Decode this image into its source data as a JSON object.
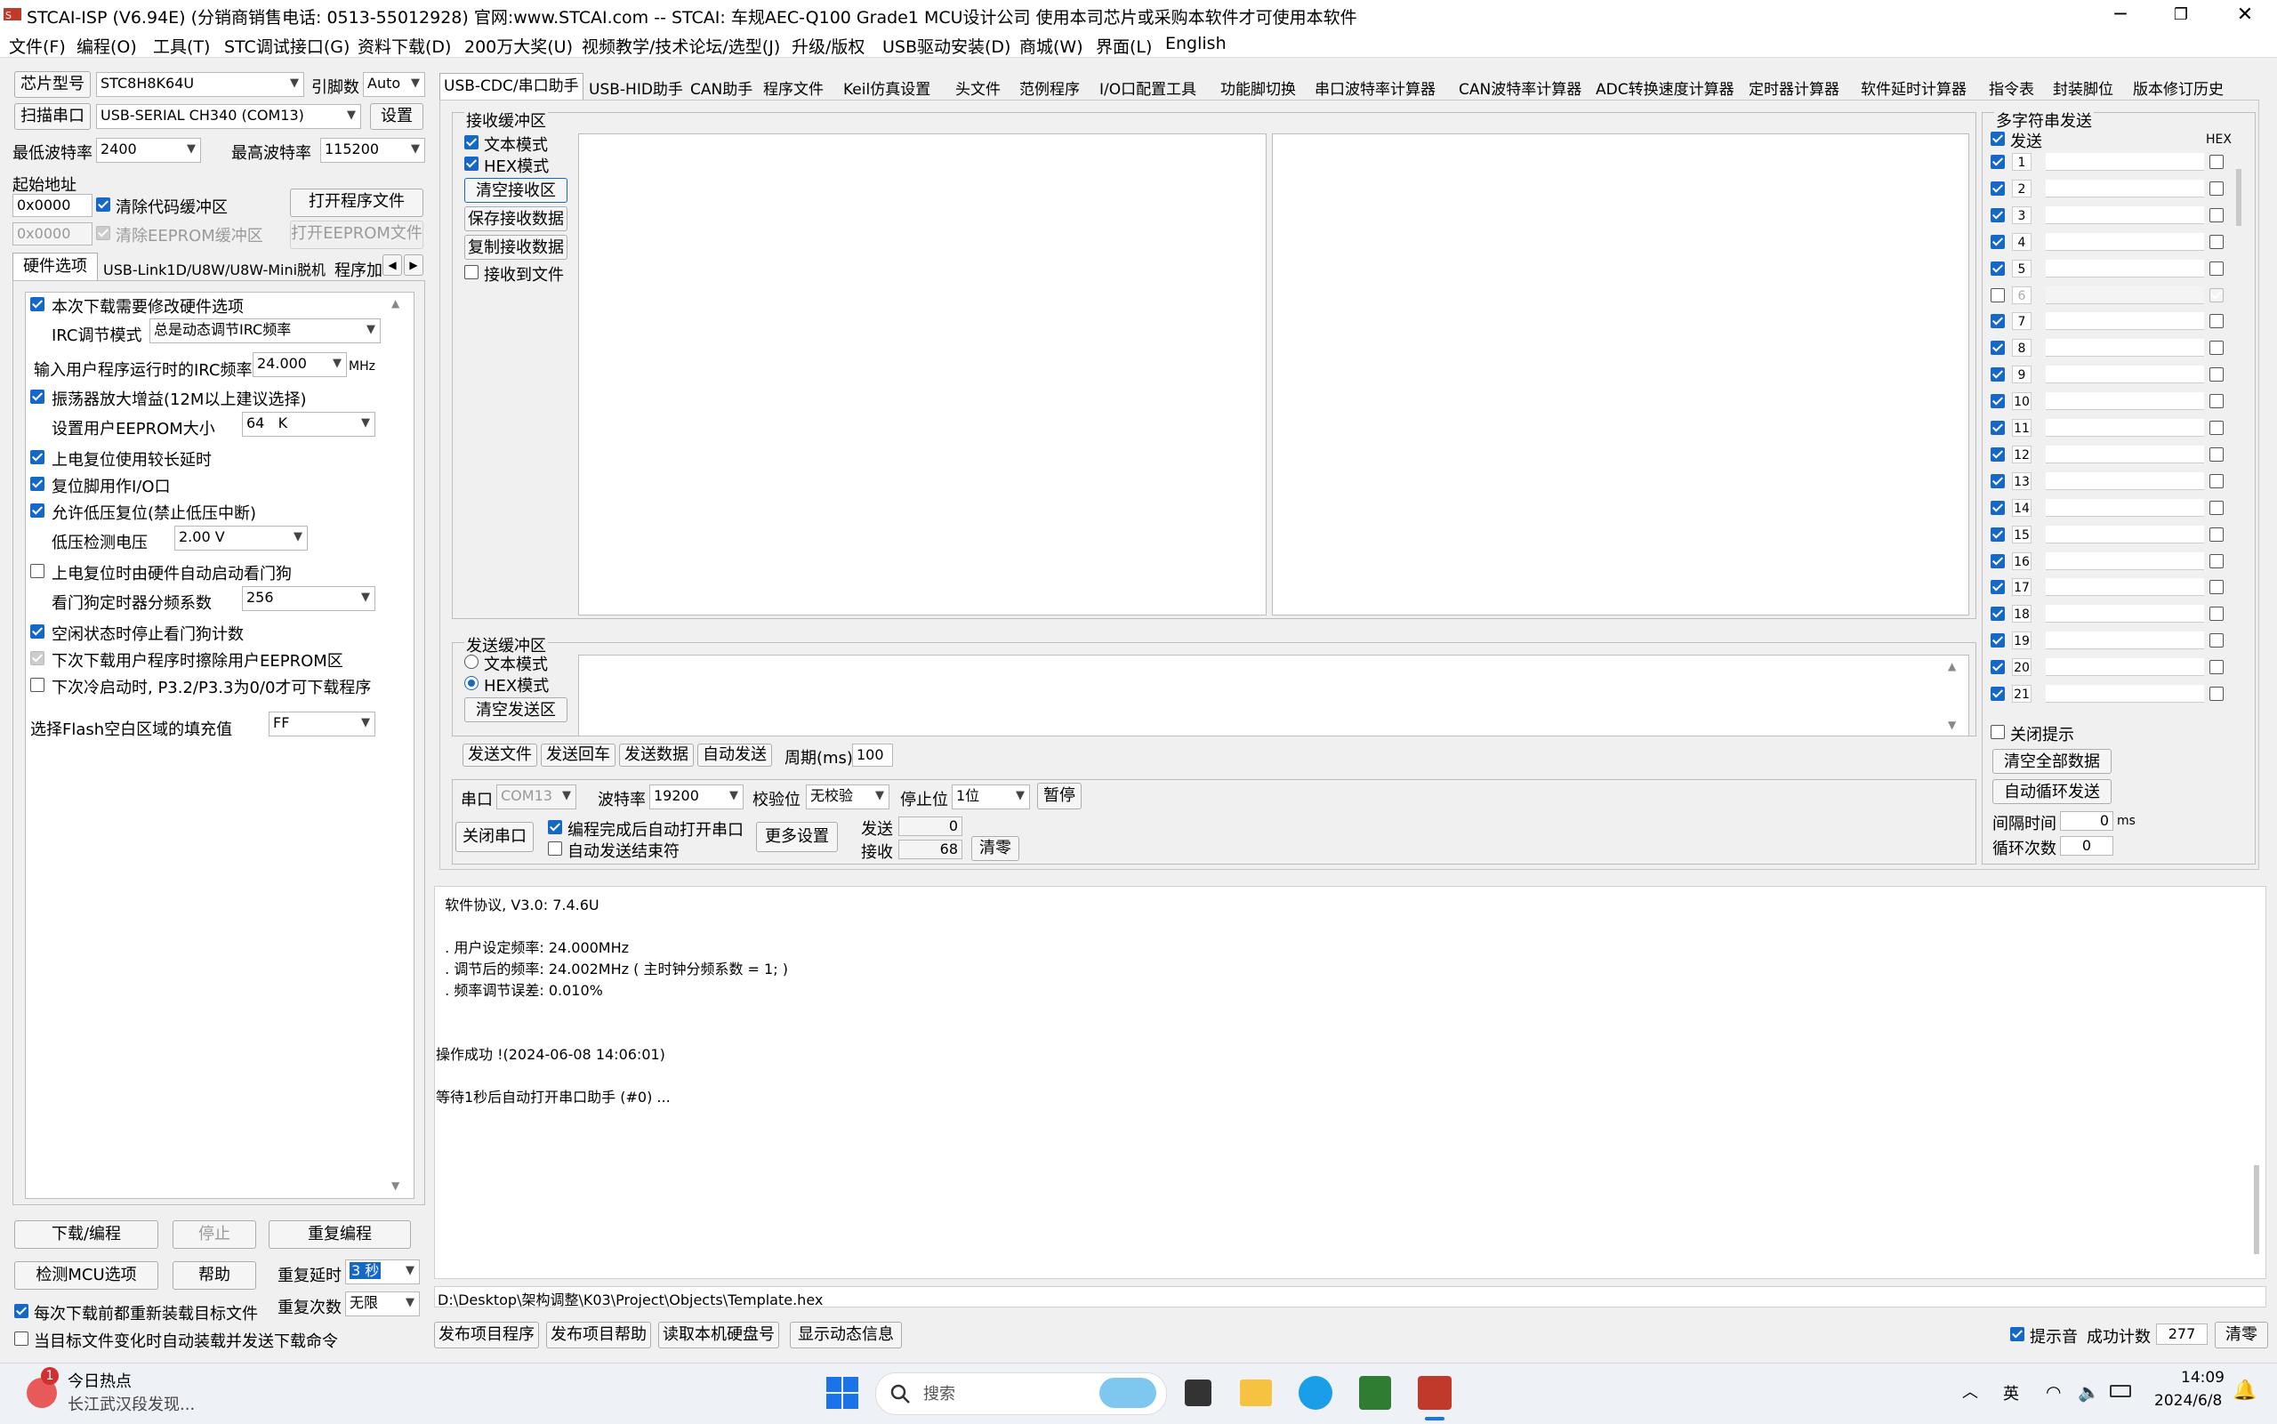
{
  "window": {
    "title": "STCAI-ISP (V6.94E) (分销商销售电话: 0513-55012928) 官网:www.STCAI.com  -- STCAI: 车规AEC-Q100 Grade1 MCU设计公司 使用本司芯片或采购本软件才可使用本软件",
    "minimize": "─",
    "maximize": "❐",
    "close": "✕"
  },
  "menu": [
    "文件(F)",
    "编程(O)",
    "工具(T)",
    "STC调试接口(G)",
    "资料下载(D)",
    "200万大奖(U)",
    "视频教学/技术论坛/选型(J)",
    "升级/版权",
    "USB驱动安装(D)",
    "商城(W)",
    "界面(L)",
    "English"
  ],
  "left": {
    "chip_label": "芯片型号",
    "chip_value": "STC8H8K64U",
    "pins_label": "引脚数",
    "pins_value": "Auto",
    "scan_btn": "扫描串口",
    "port_value": "USB-SERIAL CH340 (COM13)",
    "settings_btn": "设置",
    "min_baud_label": "最低波特率",
    "min_baud_value": "2400",
    "max_baud_label": "最高波特率",
    "max_baud_value": "115200",
    "start_addr_label": "起始地址",
    "addr1": "0x0000",
    "clear_code_label": "清除代码缓冲区",
    "open_prog_btn": "打开程序文件",
    "addr2": "0x0000",
    "clear_eeprom_label": "清除EEPROM缓冲区",
    "open_eeprom_btn": "打开EEPROM文件",
    "tabs": [
      "硬件选项",
      "USB-Link1D/U8W/U8W-Mini脱机",
      "程序加"
    ],
    "hw_options": {
      "opt1": "本次下载需要修改硬件选项",
      "irc_mode_label": "IRC调节模式",
      "irc_mode_value": "总是动态调节IRC频率",
      "irc_freq_label": "输入用户程序运行时的IRC频率",
      "irc_freq_value": "24.000",
      "irc_unit": "MHz",
      "opt_osc": "振荡器放大增益(12M以上建议选择)",
      "eeprom_size_label": "设置用户EEPROM大小",
      "eeprom_size_value": "64   K",
      "opt_reset_delay": "上电复位使用较长延时",
      "opt_reset_io": "复位脚用作I/O口",
      "opt_low_volt": "允许低压复位(禁止低压中断)",
      "low_volt_label": "低压检测电压",
      "low_volt_value": "2.00 V",
      "opt_wdt": "上电复位时由硬件自动启动看门狗",
      "wdt_div_label": "看门狗定时器分频系数",
      "wdt_div_value": "256",
      "opt_idle_wdt": "空闲状态时停止看门狗计数",
      "opt_erase_eeprom": "下次下载用户程序时擦除用户EEPROM区",
      "opt_cold_boot": "下次冷启动时, P3.2/P3.3为0/0才可下载程序",
      "flash_fill_label": "选择Flash空白区域的填充值",
      "flash_fill_value": "FF"
    },
    "download_btn": "下载/编程",
    "stop_btn": "停止",
    "reprogram_btn": "重复编程",
    "detect_btn": "检测MCU选项",
    "help_btn": "帮助",
    "repeat_delay_label": "重复延时",
    "repeat_delay_value": "3 秒",
    "repeat_count_label": "重复次数",
    "repeat_count_value": "无限",
    "reload_label": "每次下载前都重新装载目标文件",
    "auto_load_label": "当目标文件变化时自动装载并发送下载命令"
  },
  "tabs_main": [
    "USB-CDC/串口助手",
    "USB-HID助手",
    "CAN助手",
    "程序文件",
    "Keil仿真设置",
    "头文件",
    "范例程序",
    "I/O口配置工具",
    "功能脚切换",
    "串口波特率计算器",
    "CAN波特率计算器",
    "ADC转换速度计算器",
    "定时器计算器",
    "软件延时计算器",
    "指令表",
    "封装脚位",
    "版本修订历史"
  ],
  "recv": {
    "group": "接收缓冲区",
    "text_mode": "文本模式",
    "hex_mode": "HEX模式",
    "clear_btn": "清空接收区",
    "save_btn": "保存接收数据",
    "copy_btn": "复制接收数据",
    "to_file": "接收到文件"
  },
  "send": {
    "group": "发送缓冲区",
    "text_mode": "文本模式",
    "hex_mode": "HEX模式",
    "clear_btn": "清空发送区",
    "send_file": "发送文件",
    "send_cr": "发送回车",
    "send_data": "发送数据",
    "auto_send": "自动发送",
    "period_label": "周期(ms)",
    "period_value": "100"
  },
  "serial": {
    "port_label": "串口",
    "port_value": "COM13",
    "baud_label": "波特率",
    "baud_value": "19200",
    "parity_label": "校验位",
    "parity_value": "无校验",
    "stop_label": "停止位",
    "stop_value": "1位",
    "pause_btn": "暂停",
    "close_btn": "关闭串口",
    "auto_open": "编程完成后自动打开串口",
    "auto_end": "自动发送结束符",
    "more_btn": "更多设置",
    "sent_label": "发送",
    "sent_value": "0",
    "recv_label": "接收",
    "recv_value": "68",
    "reset_btn": "清零"
  },
  "multi": {
    "title": "多字符串发送",
    "send_label": "发送",
    "hex_label": "HEX",
    "rows": [
      "1",
      "2",
      "3",
      "4",
      "5",
      "6",
      "7",
      "8",
      "9",
      "10",
      "11",
      "12",
      "13",
      "14",
      "15",
      "16",
      "17",
      "18",
      "19",
      "20",
      "21"
    ],
    "close_tip": "关闭提示",
    "clear_all": "清空全部数据",
    "auto_loop": "自动循环发送",
    "interval_label": "间隔时间",
    "interval_value": "0",
    "interval_unit": "ms",
    "loop_label": "循环次数",
    "loop_value": "0"
  },
  "log": {
    "lines": [
      "  软件协议, V3.0: 7.4.6U",
      "",
      "  . 用户设定频率: 24.000MHz",
      "  . 调节后的频率: 24.002MHz ( 主时钟分频系数 = 1; )",
      "  . 频率调节误差: 0.010%",
      "",
      "",
      "操作成功 !(2024-06-08 14:06:01)",
      "",
      "等待1秒后自动打开串口助手 (#0) ..."
    ],
    "path": "D:\\Desktop\\架构调整\\K03\\Project\\Objects\\Template.hex"
  },
  "bottom": {
    "publish_prog": "发布项目程序",
    "publish_help": "发布项目帮助",
    "read_disk": "读取本机硬盘号",
    "show_dyn": "显示动态信息",
    "sound_label": "提示音",
    "success_label": "成功计数",
    "success_value": "277",
    "clear_btn": "清零"
  },
  "taskbar": {
    "news_title": "今日热点",
    "news_sub": "长江武汉段发现...",
    "badge": "1",
    "search": "搜索",
    "ime": "英",
    "time": "14:09",
    "date": "2024/6/8"
  }
}
